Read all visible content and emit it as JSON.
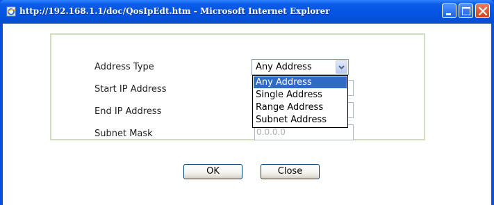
{
  "window": {
    "title": "http://192.168.1.1/doc/QosIpEdt.htm - Microsoft Internet Explorer"
  },
  "titlebar_buttons": {
    "minimize_icon": "minimize-icon",
    "maximize_icon": "maximize-icon",
    "close_icon": "close-icon"
  },
  "form": {
    "address_type_label": "Address Type",
    "start_ip_label": "Start IP Address",
    "end_ip_label": "End IP Address",
    "subnet_mask_label": "Subnet Mask",
    "subnet_mask_value": "0.0.0.0"
  },
  "address_type_select": {
    "value": "Any Address",
    "options": [
      "Any Address",
      "Single Address",
      "Range Address",
      "Subnet Address"
    ],
    "highlighted": "Any Address"
  },
  "buttons": {
    "ok": "OK",
    "close": "Close"
  },
  "colors": {
    "titlebar": "#0553e3",
    "selection": "#316ac5",
    "panel_border": "#d2dcc0"
  }
}
